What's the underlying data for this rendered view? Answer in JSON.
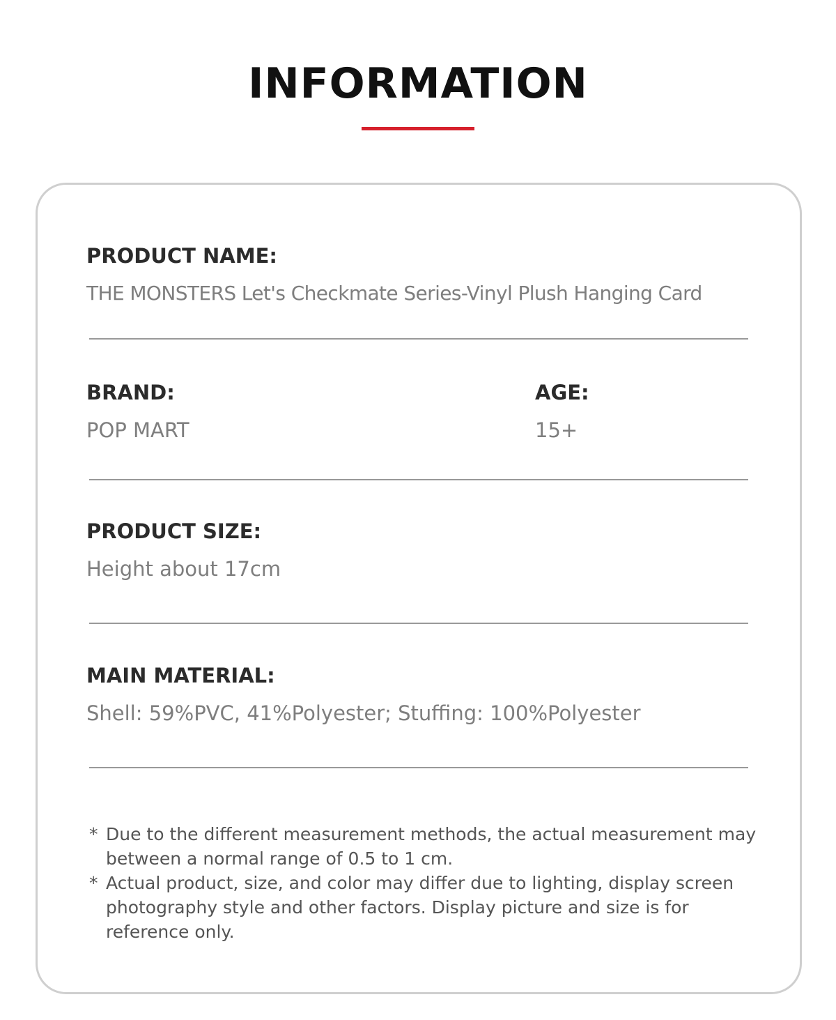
{
  "header": {
    "title": "INFORMATION",
    "accent_color": "#d6202c"
  },
  "info": {
    "product_name": {
      "label": "PRODUCT NAME:",
      "value": "THE MONSTERS Let's Checkmate Series-Vinyl Plush Hanging Card"
    },
    "brand": {
      "label": "BRAND:",
      "value": "POP MART"
    },
    "age": {
      "label": "AGE:",
      "value": "15+"
    },
    "product_size": {
      "label": "PRODUCT SIZE:",
      "value": "Height about 17cm"
    },
    "main_material": {
      "label": "MAIN MATERIAL:",
      "value": "Shell: 59%PVC, 41%Polyester; Stuffing: 100%Polyester"
    }
  },
  "notes": [
    {
      "mark": "*",
      "text": "Due to the different measurement methods, the actual measurement may between a normal range of 0.5 to 1 cm."
    },
    {
      "mark": "*",
      "text": "Actual product, size, and color may differ due to lighting, display screen photography style and other factors. Display picture and size is for reference only."
    }
  ]
}
